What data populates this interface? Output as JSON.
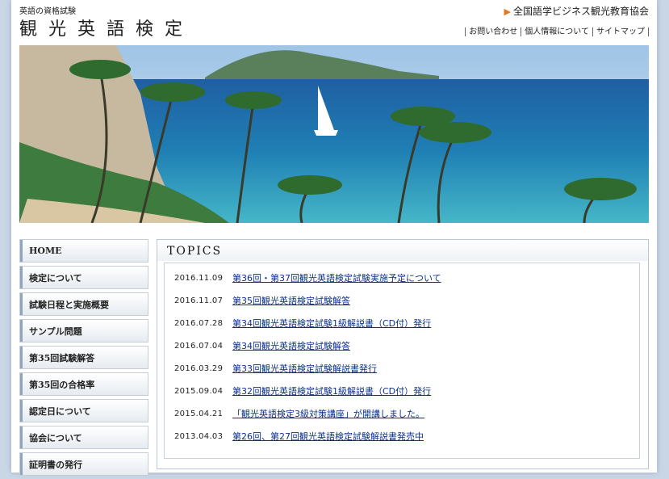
{
  "header": {
    "tagline": "英語の資格試験",
    "title": "観光英語検定",
    "organization": "全国語学ビジネス観光教育協会",
    "util_links": [
      "お問い合わせ",
      "個人情報について",
      "サイトマップ"
    ]
  },
  "sidebar": {
    "items": [
      {
        "label": "HOME"
      },
      {
        "label": "検定について"
      },
      {
        "label": "試験日程と実施概要"
      },
      {
        "label": "サンプル問題"
      },
      {
        "label": "第35回試験解答"
      },
      {
        "label": "第35回の合格率"
      },
      {
        "label": "認定日について"
      },
      {
        "label": "協会について"
      },
      {
        "label": "証明書の発行"
      }
    ]
  },
  "topics": {
    "heading": "TOPICS",
    "items": [
      {
        "date": "2016.11.09",
        "title": "第36回・第37回観光英語検定試験実施予定について"
      },
      {
        "date": "2016.11.07",
        "title": "第35回観光英語検定試験解答"
      },
      {
        "date": "2016.07.28",
        "title": "第34回観光英語検定試験1級解説書（CD付）発行"
      },
      {
        "date": "2016.07.04",
        "title": "第34回観光英語検定試験解答"
      },
      {
        "date": "2016.03.29",
        "title": "第33回観光英語検定試験解説書発行"
      },
      {
        "date": "2015.09.04",
        "title": "第32回観光英語検定試験1級解説書（CD付）発行"
      },
      {
        "date": "2015.04.21",
        "title": "「観光英語検定3級対策講座」が開講しました。"
      },
      {
        "date": "2013.04.03",
        "title": "第26回、第27回観光英語検定試験解説書発売中"
      }
    ]
  },
  "colors": {
    "accent": "#e07a1f",
    "link": "#0b2f8f",
    "background": "#c9d6e6"
  }
}
